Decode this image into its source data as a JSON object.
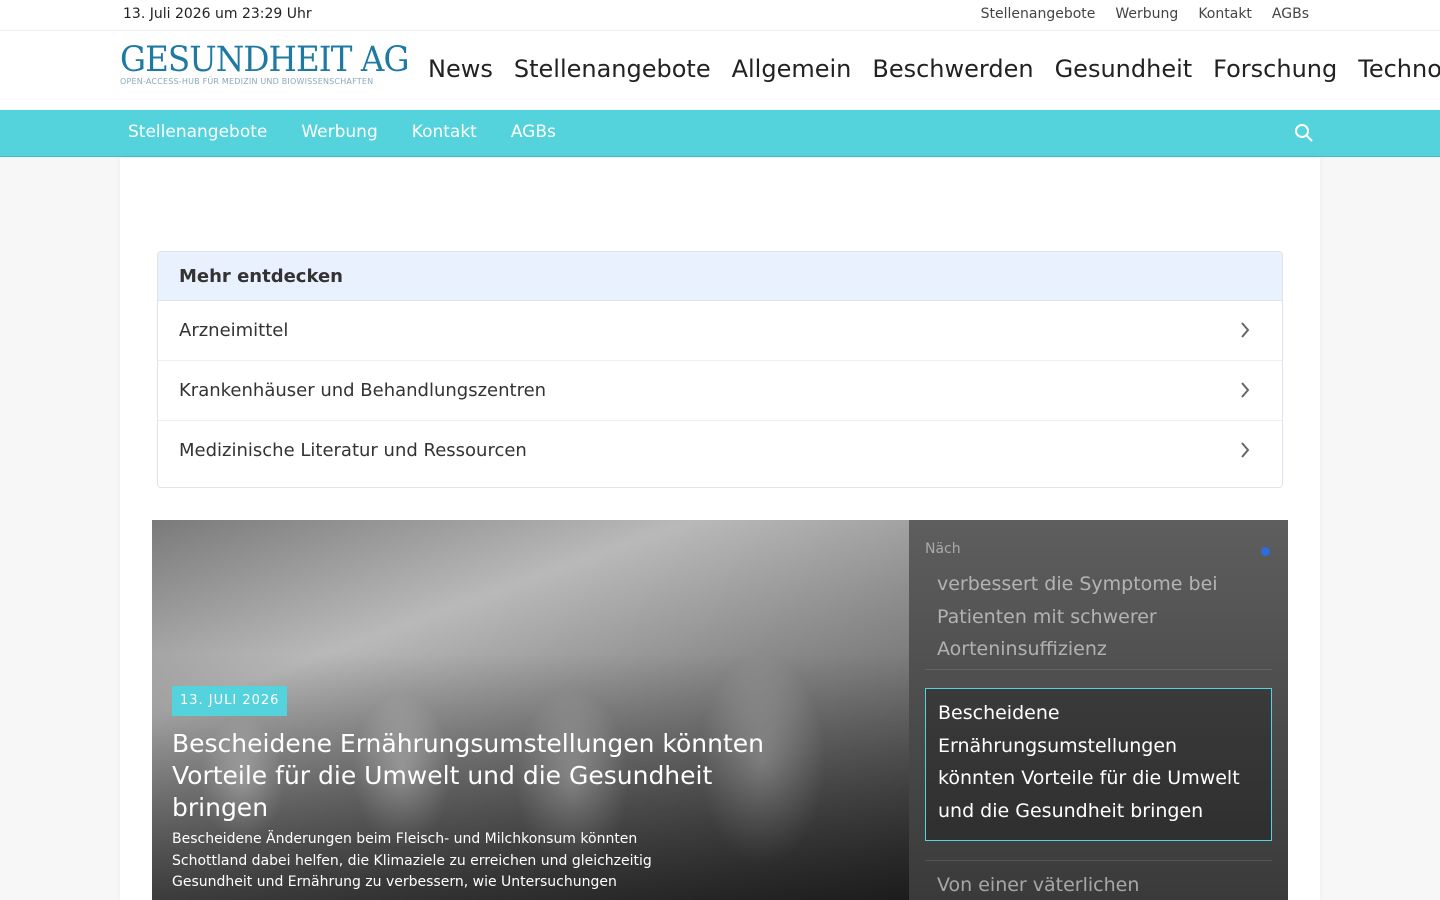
{
  "topbar": {
    "date": "13. Juli 2026 um 23:29 Uhr",
    "links": [
      "Stellenangebote",
      "Werbung",
      "Kontakt",
      "AGBs"
    ]
  },
  "logo": {
    "name": "GESUNDHEIT AG",
    "tagline": "OPEN-ACCESS-HUB FÜR MEDIZIN UND BIOWISSENSCHAFTEN"
  },
  "main_nav": [
    "News",
    "Stellenangebote",
    "Allgemein",
    "Beschwerden",
    "Gesundheit",
    "Forschung",
    "Techno"
  ],
  "sub_nav": [
    "Stellenangebote",
    "Werbung",
    "Kontakt",
    "AGBs"
  ],
  "discover": {
    "heading": "Mehr entdecken",
    "items": [
      "Arzneimittel",
      "Krankenhäuser und Behandlungszentren",
      "Medizinische Literatur und Ressourcen"
    ]
  },
  "hero": {
    "date_badge": "13. JULI 2026",
    "title": "Bescheidene Ernährungsumstellungen könnten Vorteile für die Umwelt und die Gesundheit bringen",
    "excerpt": "Bescheidene Änderungen beim Fleisch- und Milchkonsum könnten Schottland dabei helfen, die Klimaziele zu erreichen und gleichzeitig Gesundheit und Ernährung zu verbessern, wie Untersuchungen"
  },
  "sidebar": {
    "next_label": "Näch",
    "items": [
      "verbessert die Symptome bei Patienten mit schwerer Aorteninsuffizienz",
      "Bescheidene Ernährungsumstellungen könnten Vorteile für die Umwelt und die Gesundheit bringen",
      "Von einer väterlichen"
    ]
  },
  "colors": {
    "accent": "#55d3dd",
    "logo": "#1e7aa3",
    "discover_header": "#eaf1fe"
  }
}
